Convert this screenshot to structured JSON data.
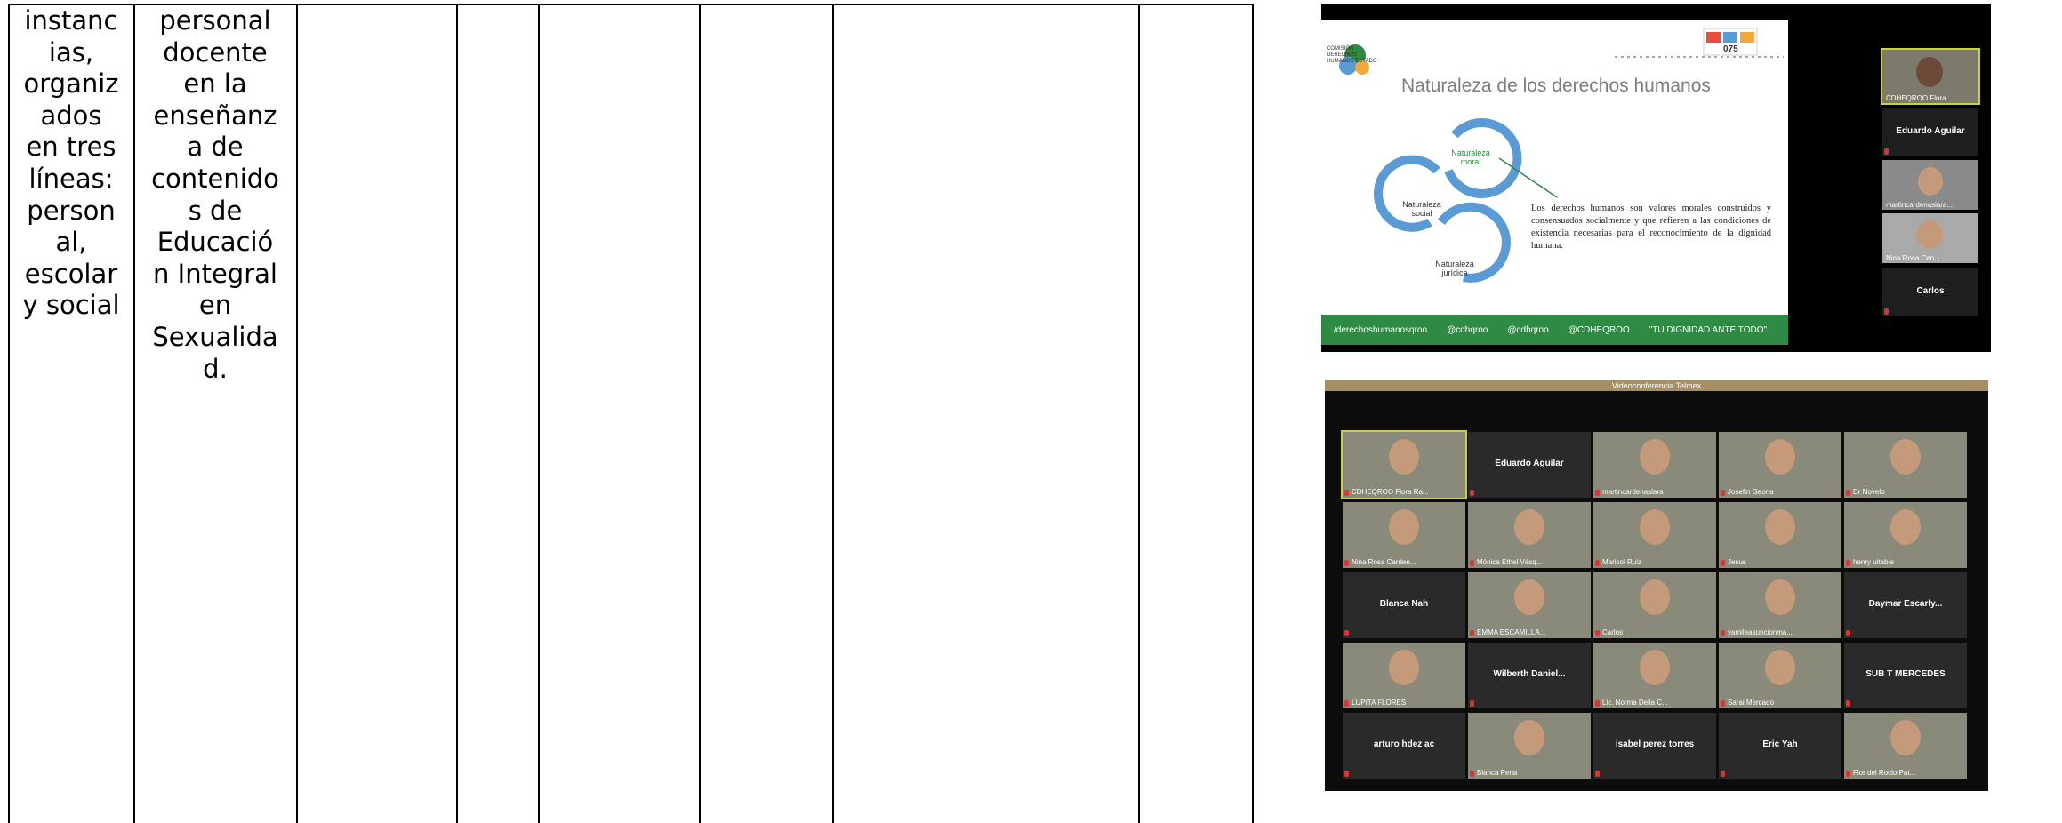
{
  "table": {
    "col1_text": "instanc\nias,\norganiz\nados\nen tres\nlíneas:\nperson\nal,\nescolar\ny social",
    "col2_text": "personal\ndocente\nen la\nenseñanz\na de\ncontenido\ns de\nEducació\nn Integral\nen\nSexualida\nd."
  },
  "slide": {
    "org_name": "COMISIÓN DERECHOS HUMANOS ESTADO",
    "badge": "075",
    "title": "Naturaleza de los derechos humanos",
    "cycle": [
      "Naturaleza moral",
      "Naturaleza social",
      "Naturaleza jurídica"
    ],
    "text": "Los derechos humanos son valores morales construidos y consensuados socialmente y que refieren a las condiciones de existencia necesarias para el reconocimiento de la dignidad humana.",
    "footer": [
      "/derechoshumanosqroo",
      "@cdhqroo",
      "@cdhqroo",
      "@CDHEQROO",
      "\"TU DIGNIDAD ANTE TODO\""
    ]
  },
  "side_participants": [
    "CDHEQROO Flora...",
    "Eduardo Aguilar",
    "martincardenaslara...",
    "Nina Rosa Cen...",
    "Carlos"
  ],
  "conference": {
    "header": "Videoconferencia Telmex",
    "tiles": [
      {
        "name": "CDHEQROO Flora Ra...",
        "video": true,
        "active": true
      },
      {
        "name": "Eduardo Aguilar",
        "video": false
      },
      {
        "name": "martincardenaslara",
        "video": true
      },
      {
        "name": "Josefin Gaona",
        "video": true
      },
      {
        "name": "Dr Novelo",
        "video": true
      },
      {
        "name": "Nina Rosa Carden...",
        "video": true
      },
      {
        "name": "Mónica Ethel Vásq...",
        "video": true
      },
      {
        "name": "Marisol Ruiz",
        "video": true
      },
      {
        "name": "Jesus",
        "video": true
      },
      {
        "name": "henry uitable",
        "video": true
      },
      {
        "name": "Blanca Nah",
        "video": false
      },
      {
        "name": "EMMA ESCAMILLA...",
        "video": true
      },
      {
        "name": "Carlos",
        "video": true
      },
      {
        "name": "yamileasuncionma...",
        "video": true
      },
      {
        "name": "Daymar Escarly...",
        "video": false
      },
      {
        "name": "LUPITA FLORES",
        "video": true
      },
      {
        "name": "Wilberth Daniel...",
        "video": false
      },
      {
        "name": "Lic. Norma Delia C...",
        "video": true
      },
      {
        "name": "Sarai Mercado",
        "video": true
      },
      {
        "name": "SUB T MERCEDES",
        "video": false
      },
      {
        "name": "arturo hdez ac",
        "video": false
      },
      {
        "name": "Blanca Pena",
        "video": true
      },
      {
        "name": "isabel perez torres",
        "video": false
      },
      {
        "name": "Eric Yah",
        "video": false
      },
      {
        "name": "Flor del Rocio Pat...",
        "video": true
      }
    ]
  },
  "colors": {
    "slide_green": "#2f8a43",
    "cycle_blue": "#5b9bd5",
    "header_tan": "#a68f63"
  }
}
